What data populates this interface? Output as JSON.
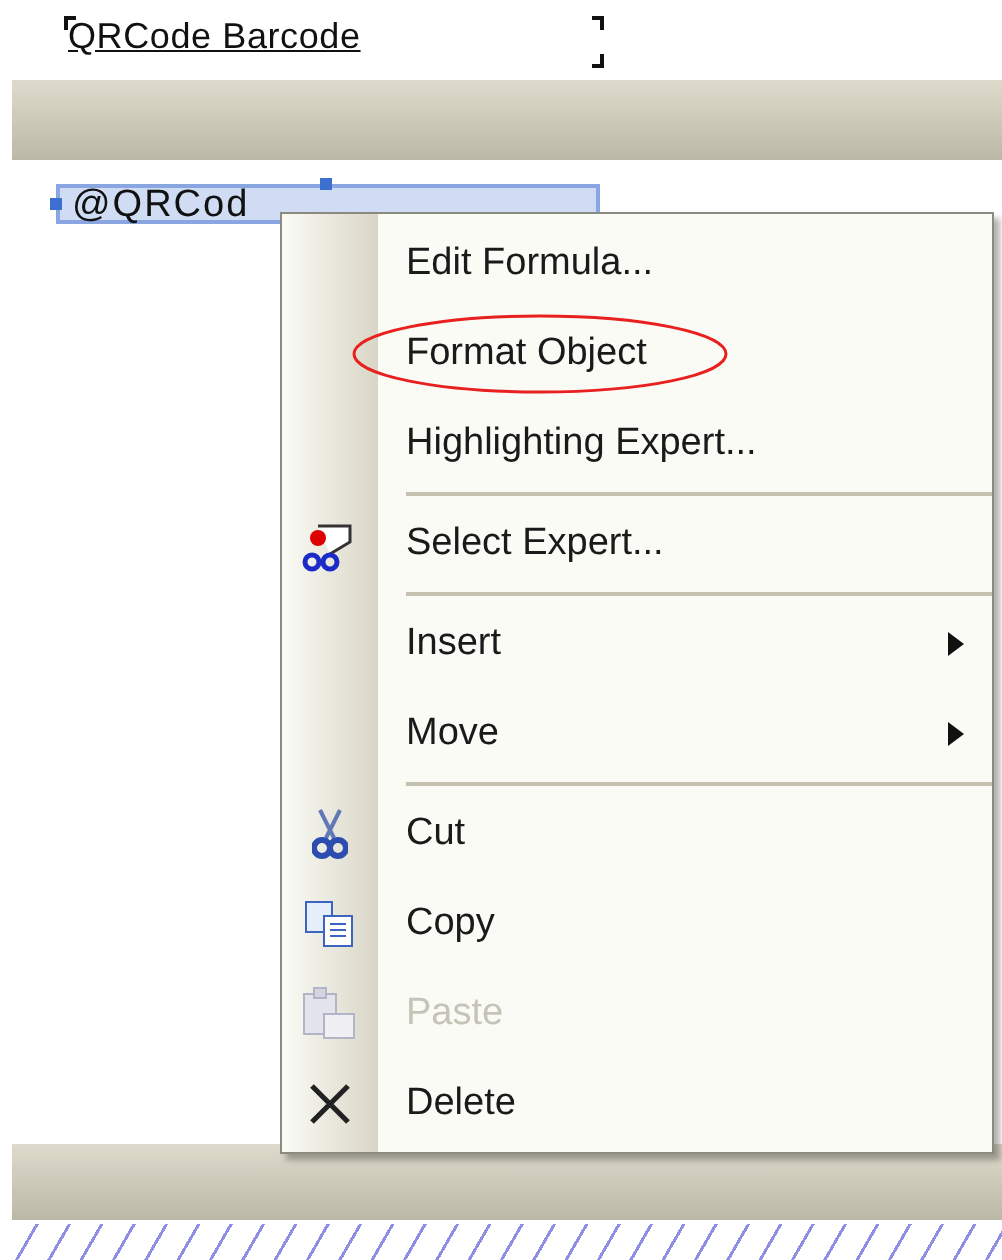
{
  "report": {
    "header_field": {
      "text": "QRCode Barcode"
    },
    "detail_field": {
      "text": "@QRCod",
      "selected": true
    }
  },
  "context_menu": {
    "entries": [
      {
        "kind": "item",
        "label": "Edit Formula...",
        "disabled": false,
        "submenu": false,
        "circled": false
      },
      {
        "kind": "item",
        "label": "Format Object",
        "disabled": false,
        "submenu": false,
        "circled": true
      },
      {
        "kind": "item",
        "label": "Highlighting Expert...",
        "disabled": false,
        "submenu": false,
        "circled": false
      },
      {
        "kind": "separator"
      },
      {
        "kind": "item",
        "label": "Select Expert...",
        "disabled": false,
        "submenu": false,
        "circled": false
      },
      {
        "kind": "separator"
      },
      {
        "kind": "item",
        "label": "Insert",
        "disabled": false,
        "submenu": true,
        "circled": false
      },
      {
        "kind": "item",
        "label": "Move",
        "disabled": false,
        "submenu": true,
        "circled": false
      },
      {
        "kind": "separator"
      },
      {
        "kind": "item",
        "label": "Cut",
        "disabled": false,
        "submenu": false,
        "circled": false
      },
      {
        "kind": "item",
        "label": "Copy",
        "disabled": false,
        "submenu": false,
        "circled": false
      },
      {
        "kind": "item",
        "label": "Paste",
        "disabled": true,
        "submenu": false,
        "circled": false
      },
      {
        "kind": "item",
        "label": "Delete",
        "disabled": false,
        "submenu": false,
        "circled": false
      }
    ]
  }
}
